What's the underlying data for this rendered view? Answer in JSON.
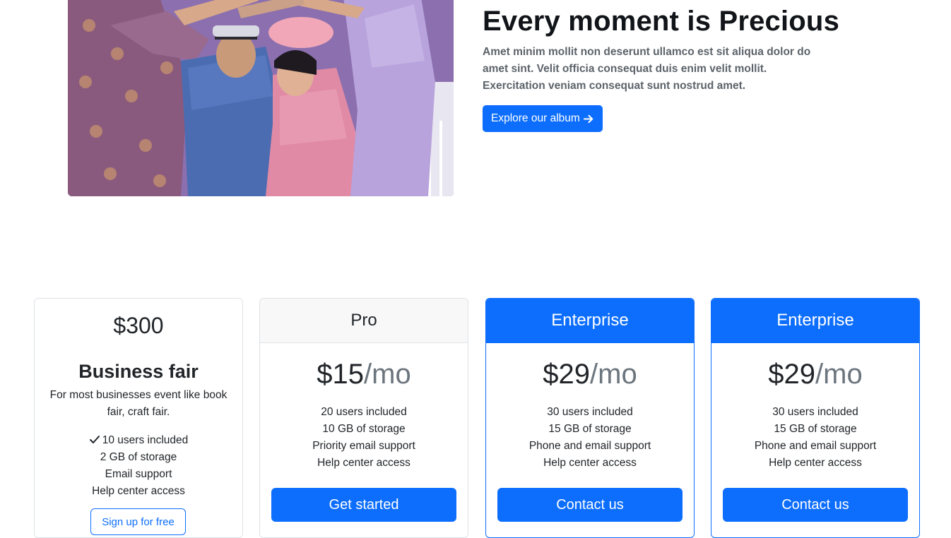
{
  "hero": {
    "image_alt": "Wedding couple walking under raised arms of guests",
    "title": "Every moment is Precious",
    "text": "Amet minim mollit non deserunt ullamco est sit aliqua dolor do amet sint. Velit officia consequat duis enim velit mollit. Exercitation veniam consequat sunt nostrud amet.",
    "button_label": "Explore our album",
    "button_icon": "arrow-right-icon"
  },
  "pricing": {
    "business": {
      "price": "$300",
      "title": "Business fair",
      "description": "For most businesses event like book fair, craft fair.",
      "features": [
        "10 users included",
        "2 GB of storage",
        "Email support",
        "Help center access"
      ],
      "button_label": "Sign up for free"
    },
    "pro": {
      "header": "Pro",
      "price": "$15",
      "per": "/mo",
      "features": [
        "20 users included",
        "10 GB of storage",
        "Priority email support",
        "Help center access"
      ],
      "button_label": "Get started"
    },
    "enterprise_1": {
      "header": "Enterprise",
      "price": "$29",
      "per": "/mo",
      "features": [
        "30 users included",
        "15 GB of storage",
        "Phone and email support",
        "Help center access"
      ],
      "button_label": "Contact us"
    },
    "enterprise_2": {
      "header": "Enterprise",
      "price": "$29",
      "per": "/mo",
      "features": [
        "30 users included",
        "15 GB of storage",
        "Phone and email support",
        "Help center access"
      ],
      "button_label": "Contact us"
    }
  },
  "colors": {
    "primary": "#0d6efd",
    "text_dark": "#212529",
    "text_muted": "#6c757d"
  }
}
